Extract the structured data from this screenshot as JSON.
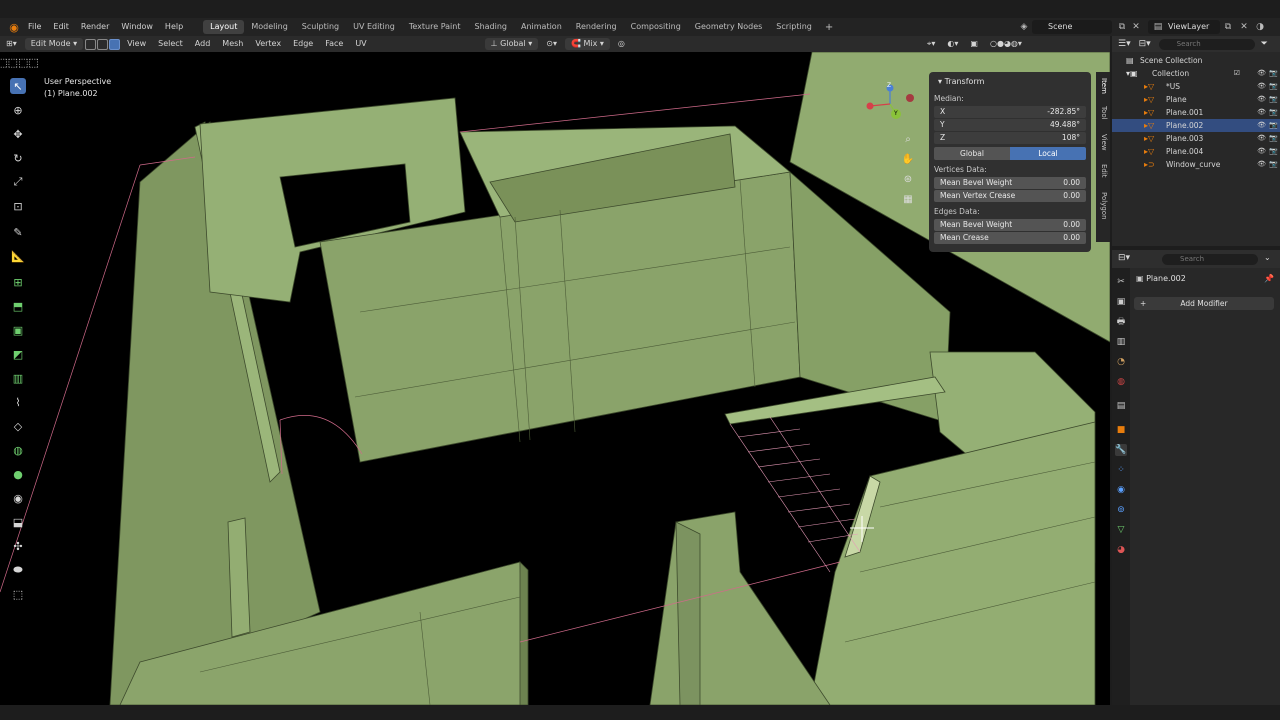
{
  "menu": {
    "items": [
      "File",
      "Edit",
      "Render",
      "Window",
      "Help"
    ],
    "workspaces": [
      "Layout",
      "Modeling",
      "Sculpting",
      "UV Editing",
      "Texture Paint",
      "Shading",
      "Animation",
      "Rendering",
      "Compositing",
      "Geometry Nodes",
      "Scripting"
    ],
    "active_workspace": "Layout",
    "plus": "+",
    "scene": "Scene",
    "view_layer": "ViewLayer"
  },
  "viewport_header": {
    "mode": "Edit Mode",
    "items": [
      "View",
      "Select",
      "Add",
      "Mesh",
      "Vertex",
      "Edge",
      "Face",
      "UV"
    ],
    "orientation": "Global",
    "snap": "Mix",
    "options": "Options",
    "axes": [
      "X",
      "Y",
      "Z"
    ]
  },
  "viewport": {
    "perspective": "User Perspective",
    "object_label": "(1) Plane.002"
  },
  "gizmo": {
    "z": "Z",
    "y": "Y"
  },
  "npanel": {
    "title": "Transform",
    "median": "Median:",
    "x_label": "X",
    "x_value": "-282.85°",
    "y_label": "Y",
    "y_value": "49.488°",
    "z_label": "Z",
    "z_value": "108°",
    "global": "Global",
    "local": "Local",
    "vertices_data": "Vertices Data:",
    "mean_bevel_weight": "Mean Bevel Weight",
    "mbw_value": "0.00",
    "mean_vertex_crease": "Mean Vertex Crease",
    "mvc_value": "0.00",
    "edges_data": "Edges Data:",
    "edge_bevel_weight": "Mean Bevel Weight",
    "ebw_value": "0.00",
    "mean_crease": "Mean Crease",
    "mc_value": "0.00"
  },
  "vtabs": [
    "Item",
    "Tool",
    "View",
    "Edit",
    "Polygon"
  ],
  "outliner": {
    "search": "Search",
    "scene_collection": "Scene Collection",
    "collection": "Collection",
    "rows": [
      "*US",
      "Plane",
      "Plane.001",
      "Plane.002",
      "Plane.003",
      "Plane.004",
      "Window_curve"
    ],
    "selected": "Plane.002"
  },
  "properties": {
    "search": "Search",
    "object": "Plane.002",
    "add_modifier": "Add Modifier"
  },
  "colors": {
    "accent": "#4772b3",
    "wall": "#8aa36a",
    "edge_select": "#f0a0c0",
    "orange": "#e87d0d"
  }
}
